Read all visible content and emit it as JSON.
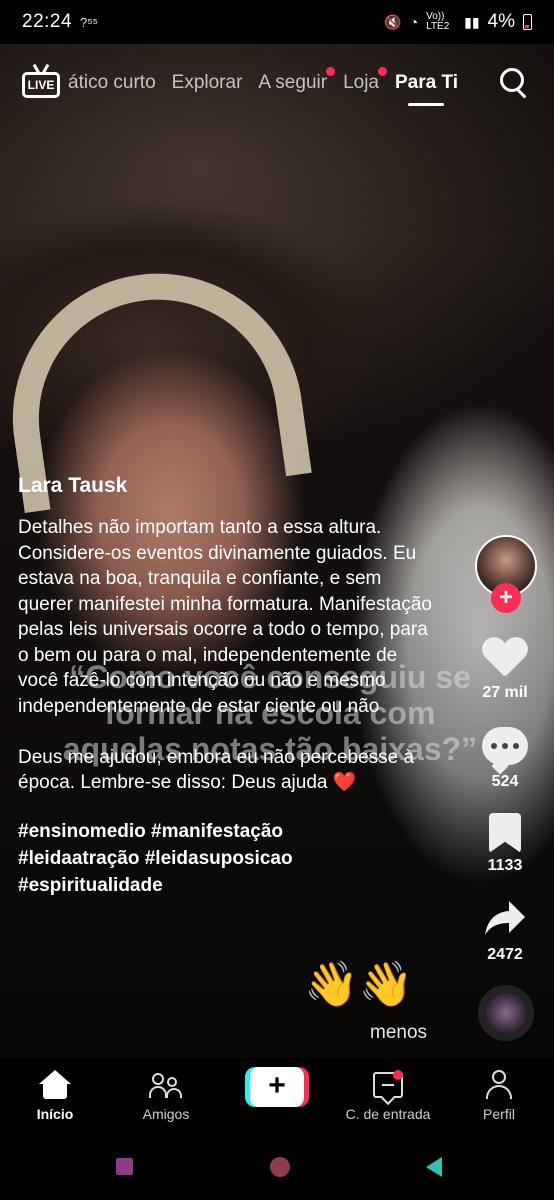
{
  "status_bar": {
    "time": "22:24",
    "left_icons": "?⁵⁵",
    "network_label": "Vo)) LTE2",
    "battery_percent": "4%"
  },
  "top_nav": {
    "live_label": "LIVE",
    "tabs": [
      {
        "label": "ático curto",
        "active": false,
        "dot": false
      },
      {
        "label": "Explorar",
        "active": false,
        "dot": false
      },
      {
        "label": "A seguir",
        "active": false,
        "dot": true
      },
      {
        "label": "Loja",
        "active": false,
        "dot": true
      },
      {
        "label": "Para Ti",
        "active": true,
        "dot": false
      }
    ]
  },
  "video": {
    "overlay_text": "“Como você conseguiu se formar na escola com aquelas notas tão baixas?”"
  },
  "caption": {
    "author": "Lara Tausk",
    "description": "Detalhes não importam tanto a essa altura. Considere-os eventos divinamente guiados. Eu estava na boa, tranquila e confiante, e sem querer manifestei minha formatura. Manifestação pelas leis universais ocorre a todo o tempo, para o bem ou para o mal, independentemente de você fazê-lo com intenção ou não e mesmo independentemente de estar ciente ou não\n\nDeus me ajudou, embora eu não percebesse à época. Lembre-se disso: Deus ajuda ❤️",
    "hashtags": [
      "#ensinomedio #manifestação",
      "#leidaatração #leidasuposicao",
      "#espiritualidade"
    ],
    "emoji": "👋",
    "less_label": "menos"
  },
  "rail": {
    "follow_symbol": "+",
    "likes": "27 mil",
    "comments": "524",
    "saves": "1133",
    "shares": "2472"
  },
  "bottom_nav": {
    "home": "Início",
    "friends": "Amigos",
    "create_symbol": "+",
    "inbox": "C. de entrada",
    "profile": "Perfil"
  },
  "colors": {
    "accent_red": "#fe2c55",
    "accent_cyan": "#25f4ee"
  }
}
